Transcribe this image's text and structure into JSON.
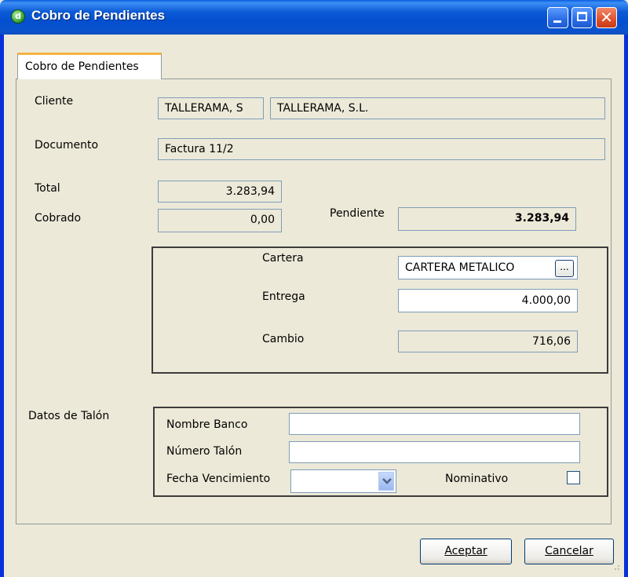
{
  "window": {
    "title": "Cobro de Pendientes",
    "icon": "app-icon",
    "controls": [
      "minimize-icon",
      "maximize-icon",
      "close-icon"
    ]
  },
  "tab": {
    "label": "Cobro de Pendientes"
  },
  "form": {
    "cliente_label": "Cliente",
    "cliente_code": "TALLERAMA, S",
    "cliente_name": "TALLERAMA, S.L.",
    "documento_label": "Documento",
    "documento_value": "Factura 11/2",
    "total_label": "Total",
    "total_value": "3.283,94",
    "cobrado_label": "Cobrado",
    "cobrado_value": "0,00",
    "pendiente_label": "Pendiente",
    "pendiente_value": "3.283,94"
  },
  "payment": {
    "cartera_label": "Cartera",
    "cartera_value": "CARTERA METALICO",
    "cartera_button": "...",
    "entrega_label": "Entrega",
    "entrega_value": "4.000,00",
    "cambio_label": "Cambio",
    "cambio_value": "716,06"
  },
  "talon": {
    "section_label": "Datos de Talón",
    "banco_label": "Nombre Banco",
    "banco_value": "",
    "numero_label": "Número Talón",
    "numero_value": "",
    "fecha_label": "Fecha Vencimiento",
    "fecha_value": "",
    "nominativo_label": "Nominativo",
    "nominativo_checked": false
  },
  "buttons": {
    "aceptar": "Aceptar",
    "cancelar": "Cancelar"
  },
  "colors": {
    "titlebar": "#0a5ad6",
    "close_button": "#e0502a",
    "tab_highlight": "#f5b341",
    "face": "#ece9d8"
  }
}
